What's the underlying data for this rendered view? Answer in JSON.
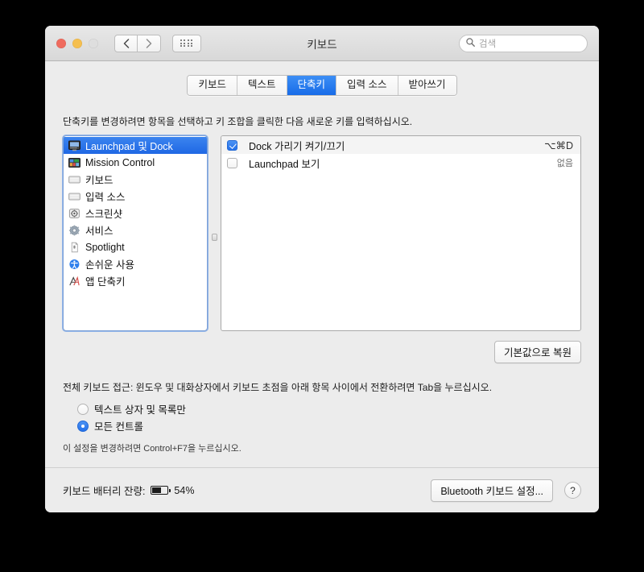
{
  "window": {
    "title": "키보드",
    "traffic_lights": [
      "close-red",
      "minimize-yellow",
      "zoom-disabled-gray"
    ],
    "nav": {
      "back_icon": "chevron-left-icon",
      "forward_icon": "chevron-right-icon",
      "grid_icon": "show-all-grid-icon"
    },
    "search": {
      "placeholder": "검색",
      "value": "",
      "icon": "search-icon"
    }
  },
  "tabs": [
    {
      "label": "키보드",
      "active": false
    },
    {
      "label": "텍스트",
      "active": false
    },
    {
      "label": "단축키",
      "active": true
    },
    {
      "label": "입력 소스",
      "active": false
    },
    {
      "label": "받아쓰기",
      "active": false
    }
  ],
  "main": {
    "hint": "단축키를 변경하려면 항목을 선택하고 키 조합을 클릭한 다음 새로운 키를 입력하십시오.",
    "categories": [
      {
        "label": "Launchpad 및 Dock",
        "icon": "dock-display-icon",
        "selected": true
      },
      {
        "label": "Mission Control",
        "icon": "mission-control-icon",
        "selected": false
      },
      {
        "label": "키보드",
        "icon": "keyboard-icon",
        "selected": false
      },
      {
        "label": "입력 소스",
        "icon": "input-sources-icon",
        "selected": false
      },
      {
        "label": "스크린샷",
        "icon": "screenshot-icon",
        "selected": false
      },
      {
        "label": "서비스",
        "icon": "services-gear-icon",
        "selected": false
      },
      {
        "label": "Spotlight",
        "icon": "spotlight-icon",
        "selected": false
      },
      {
        "label": "손쉬운 사용",
        "icon": "accessibility-icon",
        "selected": false
      },
      {
        "label": "앱 단축키",
        "icon": "app-shortcuts-icon",
        "selected": false
      }
    ],
    "shortcuts": [
      {
        "label": "Dock 가리기 켜기/끄기",
        "key": "⌥⌘D",
        "checked": true
      },
      {
        "label": "Launchpad 보기",
        "key": "없음",
        "checked": false
      }
    ],
    "restore_button": "기본값으로 복원"
  },
  "full_keyboard_access": {
    "description": "전체 키보드 접근: 윈도우 및 대화상자에서 키보드 초점을 아래 항목 사이에서 전환하려면 Tab을 누르십시오.",
    "options": [
      {
        "label": "텍스트 상자 및 목록만",
        "selected": false
      },
      {
        "label": "모든 컨트롤",
        "selected": true
      }
    ],
    "note": "이 설정을 변경하려면 Control+F7을 누르십시오."
  },
  "footer": {
    "battery_label": "키보드 배터리 잔량:",
    "battery_percent": "54%",
    "battery_icon": "battery-icon",
    "bluetooth_button": "Bluetooth 키보드 설정...",
    "help_button": "?"
  },
  "colors": {
    "accent_blue": "#1f68e4",
    "window_bg": "#ececec",
    "desktop_bg": "#000000"
  }
}
